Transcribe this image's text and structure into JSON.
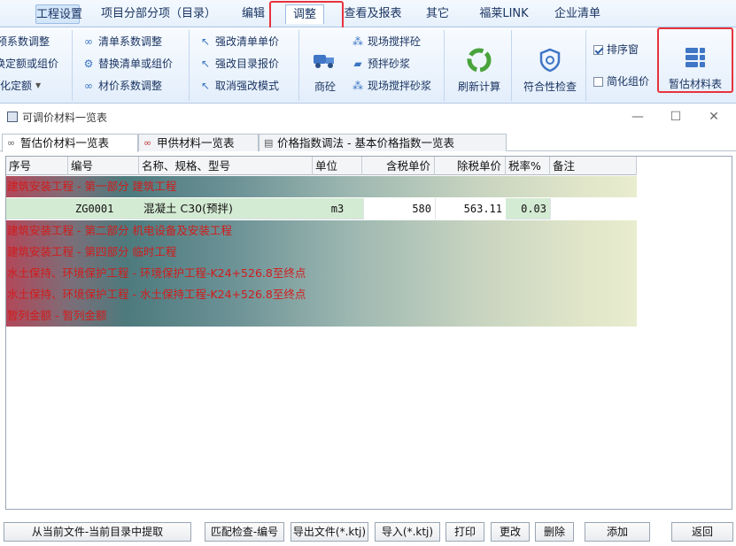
{
  "menu": {
    "tabs": [
      "工程设置",
      "项目分部分项（目录）",
      "编辑",
      "调整",
      "查看及报表",
      "其它",
      "福莱LINK",
      "企业清单"
    ],
    "active_tab": "调整"
  },
  "ribbon": {
    "group1": [
      "预系数调整",
      "换定额或组价",
      "智化定额"
    ],
    "group2": [
      "清单系数调整",
      "替换清单或组价",
      "材价系数调整"
    ],
    "group3": [
      "强改清单单价",
      "强改目录报价",
      "取消强改模式"
    ],
    "shangtong": "商砼",
    "group4": [
      "现场搅拌砼",
      "预拌砂浆",
      "现场搅拌砂浆"
    ],
    "refresh": "刷新计算",
    "compliance": "符合性检查",
    "sort_window": "排序窗",
    "simplify": "简化组价",
    "provisional_table": "暂估材料表"
  },
  "window": {
    "title": "可调价材料一览表"
  },
  "subtabs": [
    "暂估价材料一览表",
    "甲供材料一览表",
    "价格指数调法 - 基本价格指数一览表"
  ],
  "grid": {
    "headers": [
      "序号",
      "编号",
      "名称、规格、型号",
      "单位",
      "含税单价",
      "除税单价",
      "税率%",
      "备注"
    ],
    "bands": [
      "建筑安装工程 - 第一部分 建筑工程",
      "建筑安装工程 - 第二部分 机电设备及安装工程",
      "建筑安装工程 - 第四部分 临时工程",
      "水土保持、环境保护工程 - 环境保护工程-K24+526.8至终点",
      "水土保持、环境保护工程 - 水土保持工程-K24+526.8至终点",
      "暂列金额 - 暂列金额"
    ],
    "row": {
      "seq": "",
      "code": "ZG0001",
      "name": "混凝土 C30(预拌)",
      "unit": "m3",
      "price_tax": "580",
      "price_notax": "563.11",
      "tax_rate": "0.03",
      "note": ""
    }
  },
  "buttons": [
    "从当前文件-当前目录中提取",
    "匹配检查-编号",
    "导出文件(*.ktj)",
    "导入(*.ktj)",
    "打印",
    "更改",
    "删除",
    "添加",
    "返回"
  ],
  "colors": {
    "highlight_box": "#e8323c",
    "band_text": "#d11c1c",
    "row_green": "#d4ebd3"
  }
}
